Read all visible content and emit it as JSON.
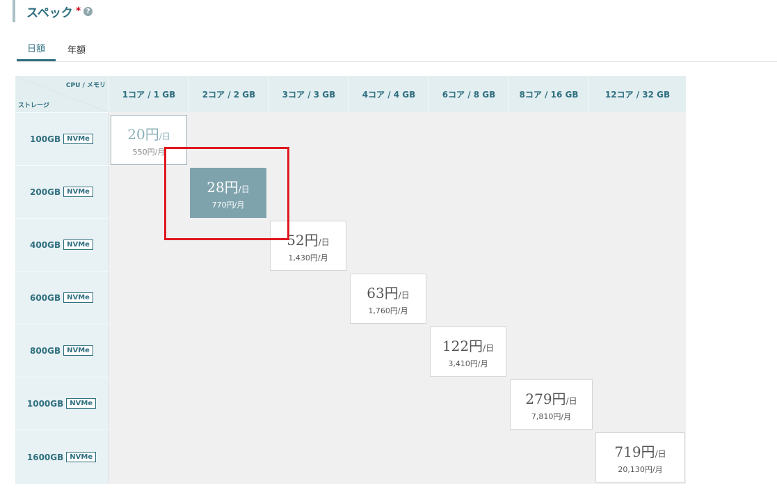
{
  "section": {
    "title": "スペック",
    "required": "*",
    "help": "?"
  },
  "tabs": [
    {
      "label": "日額"
    },
    {
      "label": "年額"
    }
  ],
  "table": {
    "corner_top": "CPU / メモリ",
    "corner_bottom": "ストレージ",
    "columns": [
      "1コア / 1 GB",
      "2コア / 2 GB",
      "3コア / 3 GB",
      "4コア / 4 GB",
      "6コア / 8 GB",
      "8コア / 16 GB",
      "12コア / 32 GB"
    ],
    "rows": [
      {
        "storage": "100GB",
        "badge": "NVMe"
      },
      {
        "storage": "200GB",
        "badge": "NVMe"
      },
      {
        "storage": "400GB",
        "badge": "NVMe"
      },
      {
        "storage": "600GB",
        "badge": "NVMe"
      },
      {
        "storage": "800GB",
        "badge": "NVMe"
      },
      {
        "storage": "1000GB",
        "badge": "NVMe"
      },
      {
        "storage": "1600GB",
        "badge": "NVMe"
      }
    ],
    "cells": [
      {
        "daily": "20円",
        "unit": "/日",
        "monthly": "550円/月",
        "state": "faded"
      },
      {
        "daily": "28円",
        "unit": "/日",
        "monthly": "770円/月",
        "state": "selected"
      },
      {
        "daily": "52円",
        "unit": "/日",
        "monthly": "1,430円/月",
        "state": "normal"
      },
      {
        "daily": "63円",
        "unit": "/日",
        "monthly": "1,760円/月",
        "state": "normal"
      },
      {
        "daily": "122円",
        "unit": "/日",
        "monthly": "3,410円/月",
        "state": "normal"
      },
      {
        "daily": "279円",
        "unit": "/日",
        "monthly": "7,810円/月",
        "state": "normal"
      },
      {
        "daily": "719円",
        "unit": "/日",
        "monthly": "20,130円/月",
        "state": "normal"
      }
    ]
  },
  "colors": {
    "accent": "#2f6f80",
    "selected": "#7fa3ad",
    "highlight": "#e0181f"
  }
}
